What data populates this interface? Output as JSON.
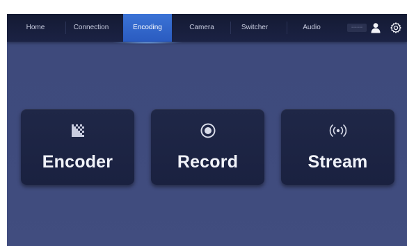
{
  "nav": {
    "tabs": [
      {
        "label": "Home"
      },
      {
        "label": "Connection"
      },
      {
        "label": "Encoding"
      },
      {
        "label": "Camera"
      },
      {
        "label": "Switcher"
      },
      {
        "label": "Audio"
      }
    ],
    "active_tab": "Encoding",
    "status_box": "====",
    "user_icon": "user-icon",
    "settings_icon": "gear-icon"
  },
  "functions": [
    {
      "label": "Encoder",
      "icon": "encoder-mosaic-icon"
    },
    {
      "label": "Record",
      "icon": "record-circle-icon"
    },
    {
      "label": "Stream",
      "icon": "broadcast-icon"
    }
  ],
  "colors": {
    "background": "#3f4b7d",
    "navbar": "#171d3a",
    "active_tab": "#2f64c9",
    "button": "#1d2444",
    "text": "#f1f3f9"
  }
}
